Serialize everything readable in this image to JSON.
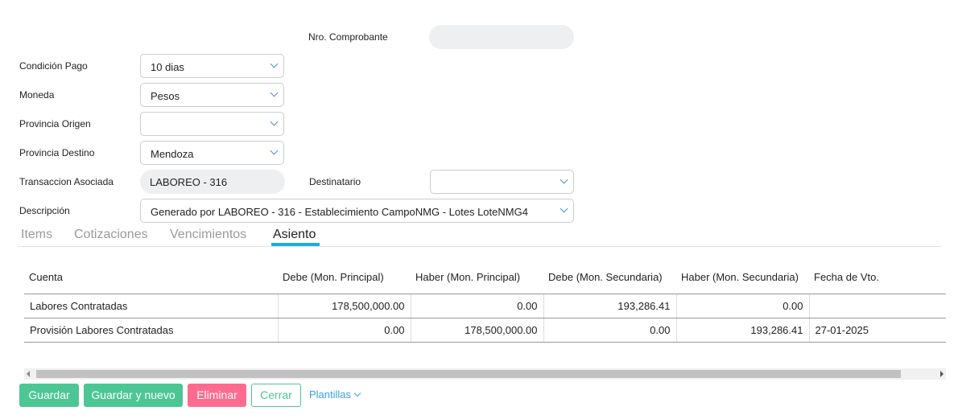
{
  "form": {
    "nro_comprobante": {
      "label": "Nro. Comprobante",
      "value": ""
    },
    "condicion_pago": {
      "label": "Condición Pago",
      "value": "10 dias"
    },
    "moneda": {
      "label": "Moneda",
      "value": "Pesos"
    },
    "provincia_origen": {
      "label": "Provincia Origen",
      "value": ""
    },
    "provincia_destino": {
      "label": "Provincia Destino",
      "value": "Mendoza"
    },
    "transaccion": {
      "label": "Transaccion Asociada",
      "value": "LABOREO - 316"
    },
    "destinatario": {
      "label": "Destinatario",
      "value": ""
    },
    "descripcion": {
      "label": "Descripción",
      "value": "Generado por LABOREO - 316 - Establecimiento CampoNMG - Lotes LoteNMG4"
    }
  },
  "tabs": [
    "Items",
    "Cotizaciones",
    "Vencimientos",
    "Asiento"
  ],
  "active_tab": "Asiento",
  "table": {
    "headers": [
      "Cuenta",
      "Debe (Mon. Principal)",
      "Haber (Mon. Principal)",
      "Debe (Mon. Secundaria)",
      "Haber (Mon. Secundaria)",
      "Fecha de Vto."
    ],
    "rows": [
      [
        "Labores Contratadas",
        "178,500,000.00",
        "0.00",
        "193,286.41",
        "0.00",
        ""
      ],
      [
        "Provisión Labores Contratadas",
        "0.00",
        "178,500,000.00",
        "0.00",
        "193,286.41",
        "27-01-2025"
      ]
    ]
  },
  "buttons": {
    "guardar": "Guardar",
    "guardar_nuevo": "Guardar y nuevo",
    "eliminar": "Eliminar",
    "cerrar": "Cerrar",
    "plantillas": "Plantillas"
  },
  "colors": {
    "green": "#4dc695",
    "pink": "#ff6b8f",
    "link": "#3a9ef0",
    "tab_accent": "#1aafd3"
  }
}
